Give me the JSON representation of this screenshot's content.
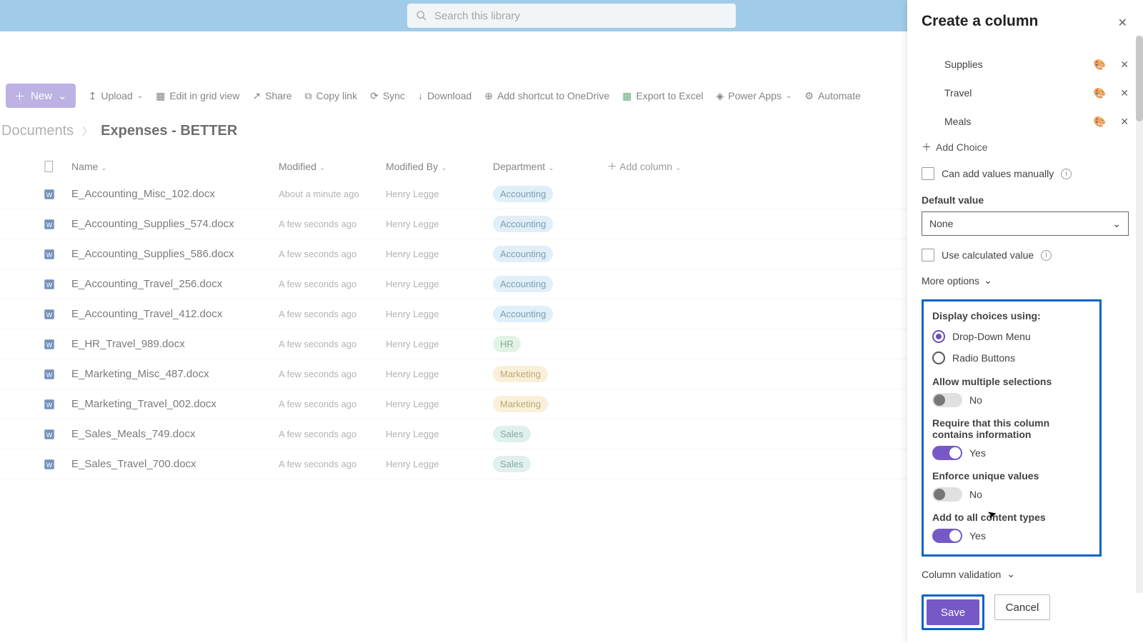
{
  "search": {
    "placeholder": "Search this library"
  },
  "toolbar": {
    "new": "New",
    "upload": "Upload",
    "edit_grid": "Edit in grid view",
    "share": "Share",
    "copy_link": "Copy link",
    "sync": "Sync",
    "download": "Download",
    "onedrive": "Add shortcut to OneDrive",
    "excel": "Export to Excel",
    "power_apps": "Power Apps",
    "automate": "Automate"
  },
  "breadcrumbs": {
    "root": "Documents",
    "current": "Expenses - BETTER"
  },
  "columns": {
    "name": "Name",
    "modified": "Modified",
    "modified_by": "Modified By",
    "department": "Department",
    "add": "Add column"
  },
  "rows": [
    {
      "name": "E_Accounting_Misc_102.docx",
      "modified": "About a minute ago",
      "modified_by": "Henry Legge",
      "dept": "Accounting",
      "dept_cls": "pill-acc"
    },
    {
      "name": "E_Accounting_Supplies_574.docx",
      "modified": "A few seconds ago",
      "modified_by": "Henry Legge",
      "dept": "Accounting",
      "dept_cls": "pill-acc"
    },
    {
      "name": "E_Accounting_Supplies_586.docx",
      "modified": "A few seconds ago",
      "modified_by": "Henry Legge",
      "dept": "Accounting",
      "dept_cls": "pill-acc"
    },
    {
      "name": "E_Accounting_Travel_256.docx",
      "modified": "A few seconds ago",
      "modified_by": "Henry Legge",
      "dept": "Accounting",
      "dept_cls": "pill-acc"
    },
    {
      "name": "E_Accounting_Travel_412.docx",
      "modified": "A few seconds ago",
      "modified_by": "Henry Legge",
      "dept": "Accounting",
      "dept_cls": "pill-acc"
    },
    {
      "name": "E_HR_Travel_989.docx",
      "modified": "A few seconds ago",
      "modified_by": "Henry Legge",
      "dept": "HR",
      "dept_cls": "pill-hr"
    },
    {
      "name": "E_Marketing_Misc_487.docx",
      "modified": "A few seconds ago",
      "modified_by": "Henry Legge",
      "dept": "Marketing",
      "dept_cls": "pill-mkt"
    },
    {
      "name": "E_Marketing_Travel_002.docx",
      "modified": "A few seconds ago",
      "modified_by": "Henry Legge",
      "dept": "Marketing",
      "dept_cls": "pill-mkt"
    },
    {
      "name": "E_Sales_Meals_749.docx",
      "modified": "A few seconds ago",
      "modified_by": "Henry Legge",
      "dept": "Sales",
      "dept_cls": "pill-sales"
    },
    {
      "name": "E_Sales_Travel_700.docx",
      "modified": "A few seconds ago",
      "modified_by": "Henry Legge",
      "dept": "Sales",
      "dept_cls": "pill-sales"
    }
  ],
  "panel": {
    "title": "Create a column",
    "choices": [
      "Supplies",
      "Travel",
      "Meals"
    ],
    "add_choice": "Add Choice",
    "manual_add": "Can add values manually",
    "default_label": "Default value",
    "default_value": "None",
    "use_calc": "Use calculated value",
    "more_options": "More options",
    "display_choices": "Display choices using:",
    "drop_down": "Drop-Down Menu",
    "radio_buttons": "Radio Buttons",
    "allow_multi": "Allow multiple selections",
    "allow_multi_val": "No",
    "require_label": "Require that this column contains information",
    "require_val": "Yes",
    "unique_label": "Enforce unique values",
    "unique_val": "No",
    "add_types_label": "Add to all content types",
    "add_types_val": "Yes",
    "column_validation": "Column validation",
    "save": "Save",
    "cancel": "Cancel"
  }
}
